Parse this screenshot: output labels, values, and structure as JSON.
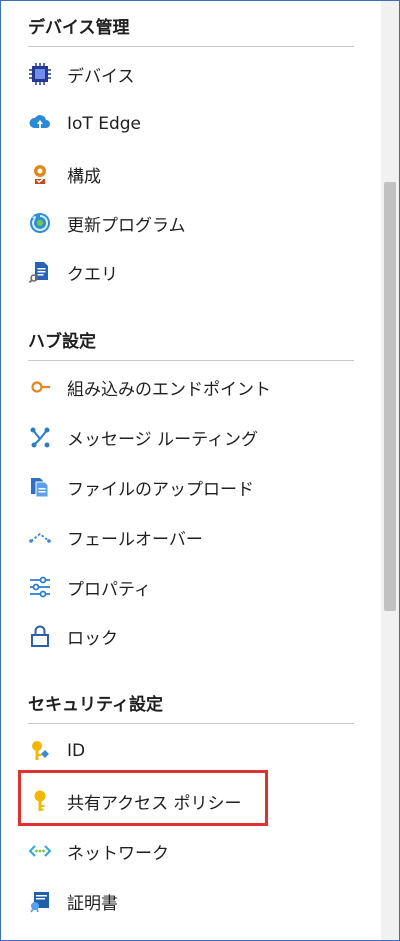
{
  "sections": [
    {
      "title": "デバイス管理",
      "items": [
        {
          "label": "デバイス",
          "icon": "chip-icon"
        },
        {
          "label": "IoT Edge",
          "icon": "cloud-edge-icon"
        },
        {
          "label": "構成",
          "icon": "configuration-icon"
        },
        {
          "label": "更新プログラム",
          "icon": "update-icon"
        },
        {
          "label": "クエリ",
          "icon": "query-document-icon"
        }
      ]
    },
    {
      "title": "ハブ設定",
      "items": [
        {
          "label": "組み込みのエンドポイント",
          "icon": "endpoint-icon"
        },
        {
          "label": "メッセージ ルーティング",
          "icon": "routing-icon"
        },
        {
          "label": "ファイルのアップロード",
          "icon": "file-upload-icon"
        },
        {
          "label": "フェールオーバー",
          "icon": "failover-icon"
        },
        {
          "label": "プロパティ",
          "icon": "properties-sliders-icon"
        },
        {
          "label": "ロック",
          "icon": "lock-icon"
        }
      ]
    },
    {
      "title": "セキュリティ設定",
      "items": [
        {
          "label": "ID",
          "icon": "identity-key-icon"
        },
        {
          "label": "共有アクセス ポリシー",
          "icon": "key-icon"
        },
        {
          "label": "ネットワーク",
          "icon": "network-icon"
        },
        {
          "label": "証明書",
          "icon": "certificate-icon"
        }
      ]
    }
  ],
  "colors": {
    "highlight_border": "#e03131",
    "frame_border": "#3b6fb6",
    "divider": "#c8c8c8"
  }
}
